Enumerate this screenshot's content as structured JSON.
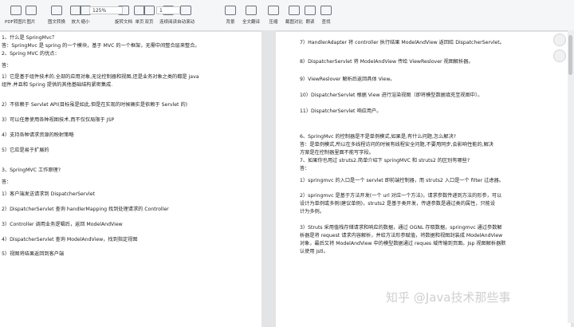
{
  "toolbar": {
    "buttons": [
      {
        "id": "pdf-to-word",
        "label": "PDF转图片"
      },
      {
        "id": "to-image",
        "label": "图片"
      },
      {
        "id": "ocr",
        "label": "图文转换"
      },
      {
        "id": "zoom-in",
        "label": "放大"
      },
      {
        "id": "zoom-out",
        "label": "缩小"
      },
      {
        "id": "rotate",
        "label": "旋转文档"
      },
      {
        "id": "single",
        "label": "单页"
      },
      {
        "id": "double",
        "label": "双页"
      },
      {
        "id": "continuous",
        "label": "连续阅读"
      },
      {
        "id": "auto-scroll",
        "label": "自动滚动"
      },
      {
        "id": "background",
        "label": "背景"
      },
      {
        "id": "translate",
        "label": "全文翻译"
      },
      {
        "id": "compress",
        "label": "压缩"
      },
      {
        "id": "screenshot",
        "label": "截图对比"
      },
      {
        "id": "read",
        "label": "朗读"
      },
      {
        "id": "find",
        "label": "查找"
      }
    ],
    "zoom_value": "125%",
    "page_value": "1"
  },
  "left_page": [
    "1、什么是 SpringMvc？",
    "答：SpringMvc 是 spring 的一个模块，基于 MVC 的一个框架，无需中间整合层来整合。",
    "2、Spring MVC 的优点：",
    "答：",
    "1）它是基于组件技术的.全部的应用对象,无论控制器和视图,还是业务对象之类的都是 java",
    "组件.并且和 Spring 提供的其他基础结构紧密集成.",
    "2）不依赖于 Servlet API(目标虽是如此,但是在实现的时候确实是依赖于 Servlet 的)",
    "3）可以任意使用各种视图技术,而不仅仅局限于 JSP",
    "4）支持各种请求资源的映射策略",
    "5）它应是易于扩展的",
    "3、SpringMVC 工作原理?",
    "答：",
    "1）客户端发送请求到 DispatcherServlet",
    "2）DispatcherServlet 查询 handlerMapping 找到处理请求的 Controller",
    "3）Controller 调用业务逻辑后，返回 ModelAndView",
    "4）DispatcherServlet 查询 ModelAndView，找到指定视图",
    "5）视图将结果返回到客户端"
  ],
  "right_page": [
    "7）HandlerAdapter 将 controller 执行结果 ModelAndView 返回给 DispatcherServlet。",
    "8）DispatcherServlet 将 ModelAndView 传给 ViewReslover 视图解析器。",
    "9）ViewReslover 解析后返回具体 View。",
    "10）DispatcherServlet 根据 View 进行渲染视图（即将模型数据填充至视图中）。",
    "11）DispatcherServlet 响应用户。",
    "6、SpringMvc 的控制器是不是单例模式,如果是,有什么问题,怎么解决?",
    "答：是单例模式,所以在多线程访问的时候有线程安全问题,不要用同步,会影响性能的,解决",
    "方案是在控制器里面不能写字段。",
    "7、如果你也用过 struts2.简单介绍下 springMVC 和 struts2 的区别有哪些?",
    "答：",
    "1）springmvc 的入口是一个 servlet 即前端控制器，而 struts2 入口是一个 filter 过虑器。",
    "2）springmvc 是基于方法开发(一个 url 对应一个方法)，请求参数传递到方法的形参，可以",
    "设计为单例或多例(建议单例)，struts2 是基于类开发，传递参数是通过类的属性，只能设",
    "计为多例。",
    "3）Struts 采用值栈存储请求和响应的数据，通过 OGNL 存取数据，springmvc 通过参数解",
    "析器是将 request 请求内容解析，并给方法形参赋值，将数据和视图封装成 ModelAndView",
    "对象，最后又将 ModelAndView 中的模型数据通过 reques 域传输到页面。Jsp 视图解析器默",
    "认使用 jstl。"
  ],
  "watermark": "知乎 @Java技术那些事"
}
